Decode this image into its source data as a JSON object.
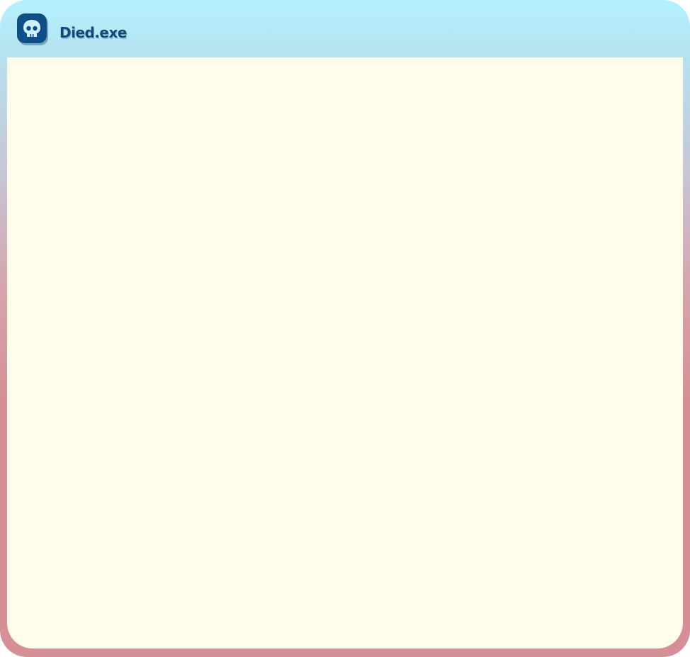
{
  "window": {
    "title": "Died.exe",
    "icon": "skull-icon"
  },
  "colors": {
    "titlebar_top": "#b3f1ff",
    "frame_bottom": "#d68f96",
    "content_background": "#fffce9",
    "title_text": "#124a7c",
    "icon_background": "#0f4f87"
  }
}
